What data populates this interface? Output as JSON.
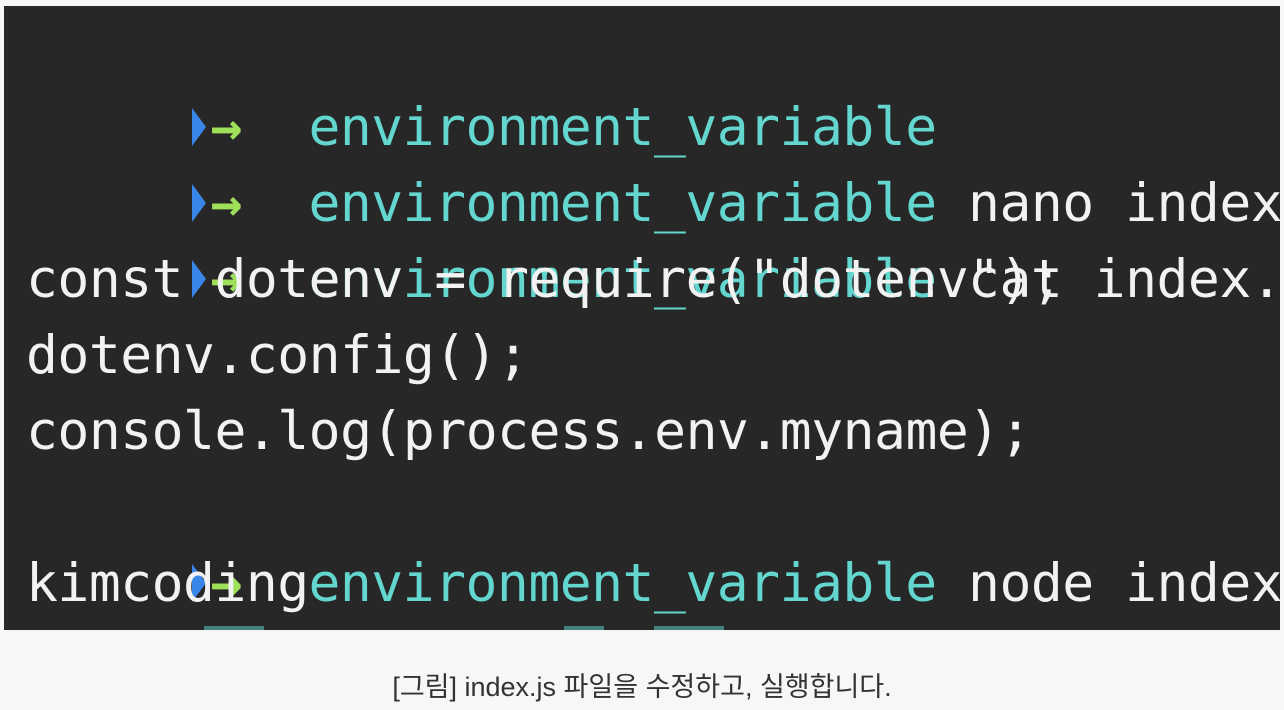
{
  "terminal": {
    "lines": [
      {
        "kind": "prompt",
        "arrow": "→",
        "dir": "environment_variable",
        "cmd": ""
      },
      {
        "kind": "prompt",
        "arrow": "→",
        "dir": "environment_variable",
        "cmd": " nano index.js"
      },
      {
        "kind": "prompt",
        "arrow": "→",
        "dir": "environment_variable",
        "cmd": " cat index.js"
      },
      {
        "kind": "output",
        "text": "const dotenv = require(\"dotenv\");"
      },
      {
        "kind": "output",
        "text": "dotenv.config();"
      },
      {
        "kind": "output",
        "text": "console.log(process.env.myname);"
      },
      {
        "kind": "prompt",
        "arrow": "→",
        "dir": "environment_variable",
        "cmd": " node index.js"
      },
      {
        "kind": "output",
        "text": "kimcoding"
      }
    ]
  },
  "colors": {
    "terminal_bg": "#272727",
    "prompt_marker": "#3a86e8",
    "prompt_arrow": "#9ee05a",
    "directory": "#63d7cf",
    "text": "#f2f2f2"
  },
  "caption": "[그림] index.js 파일을 수정하고, 실행합니다."
}
